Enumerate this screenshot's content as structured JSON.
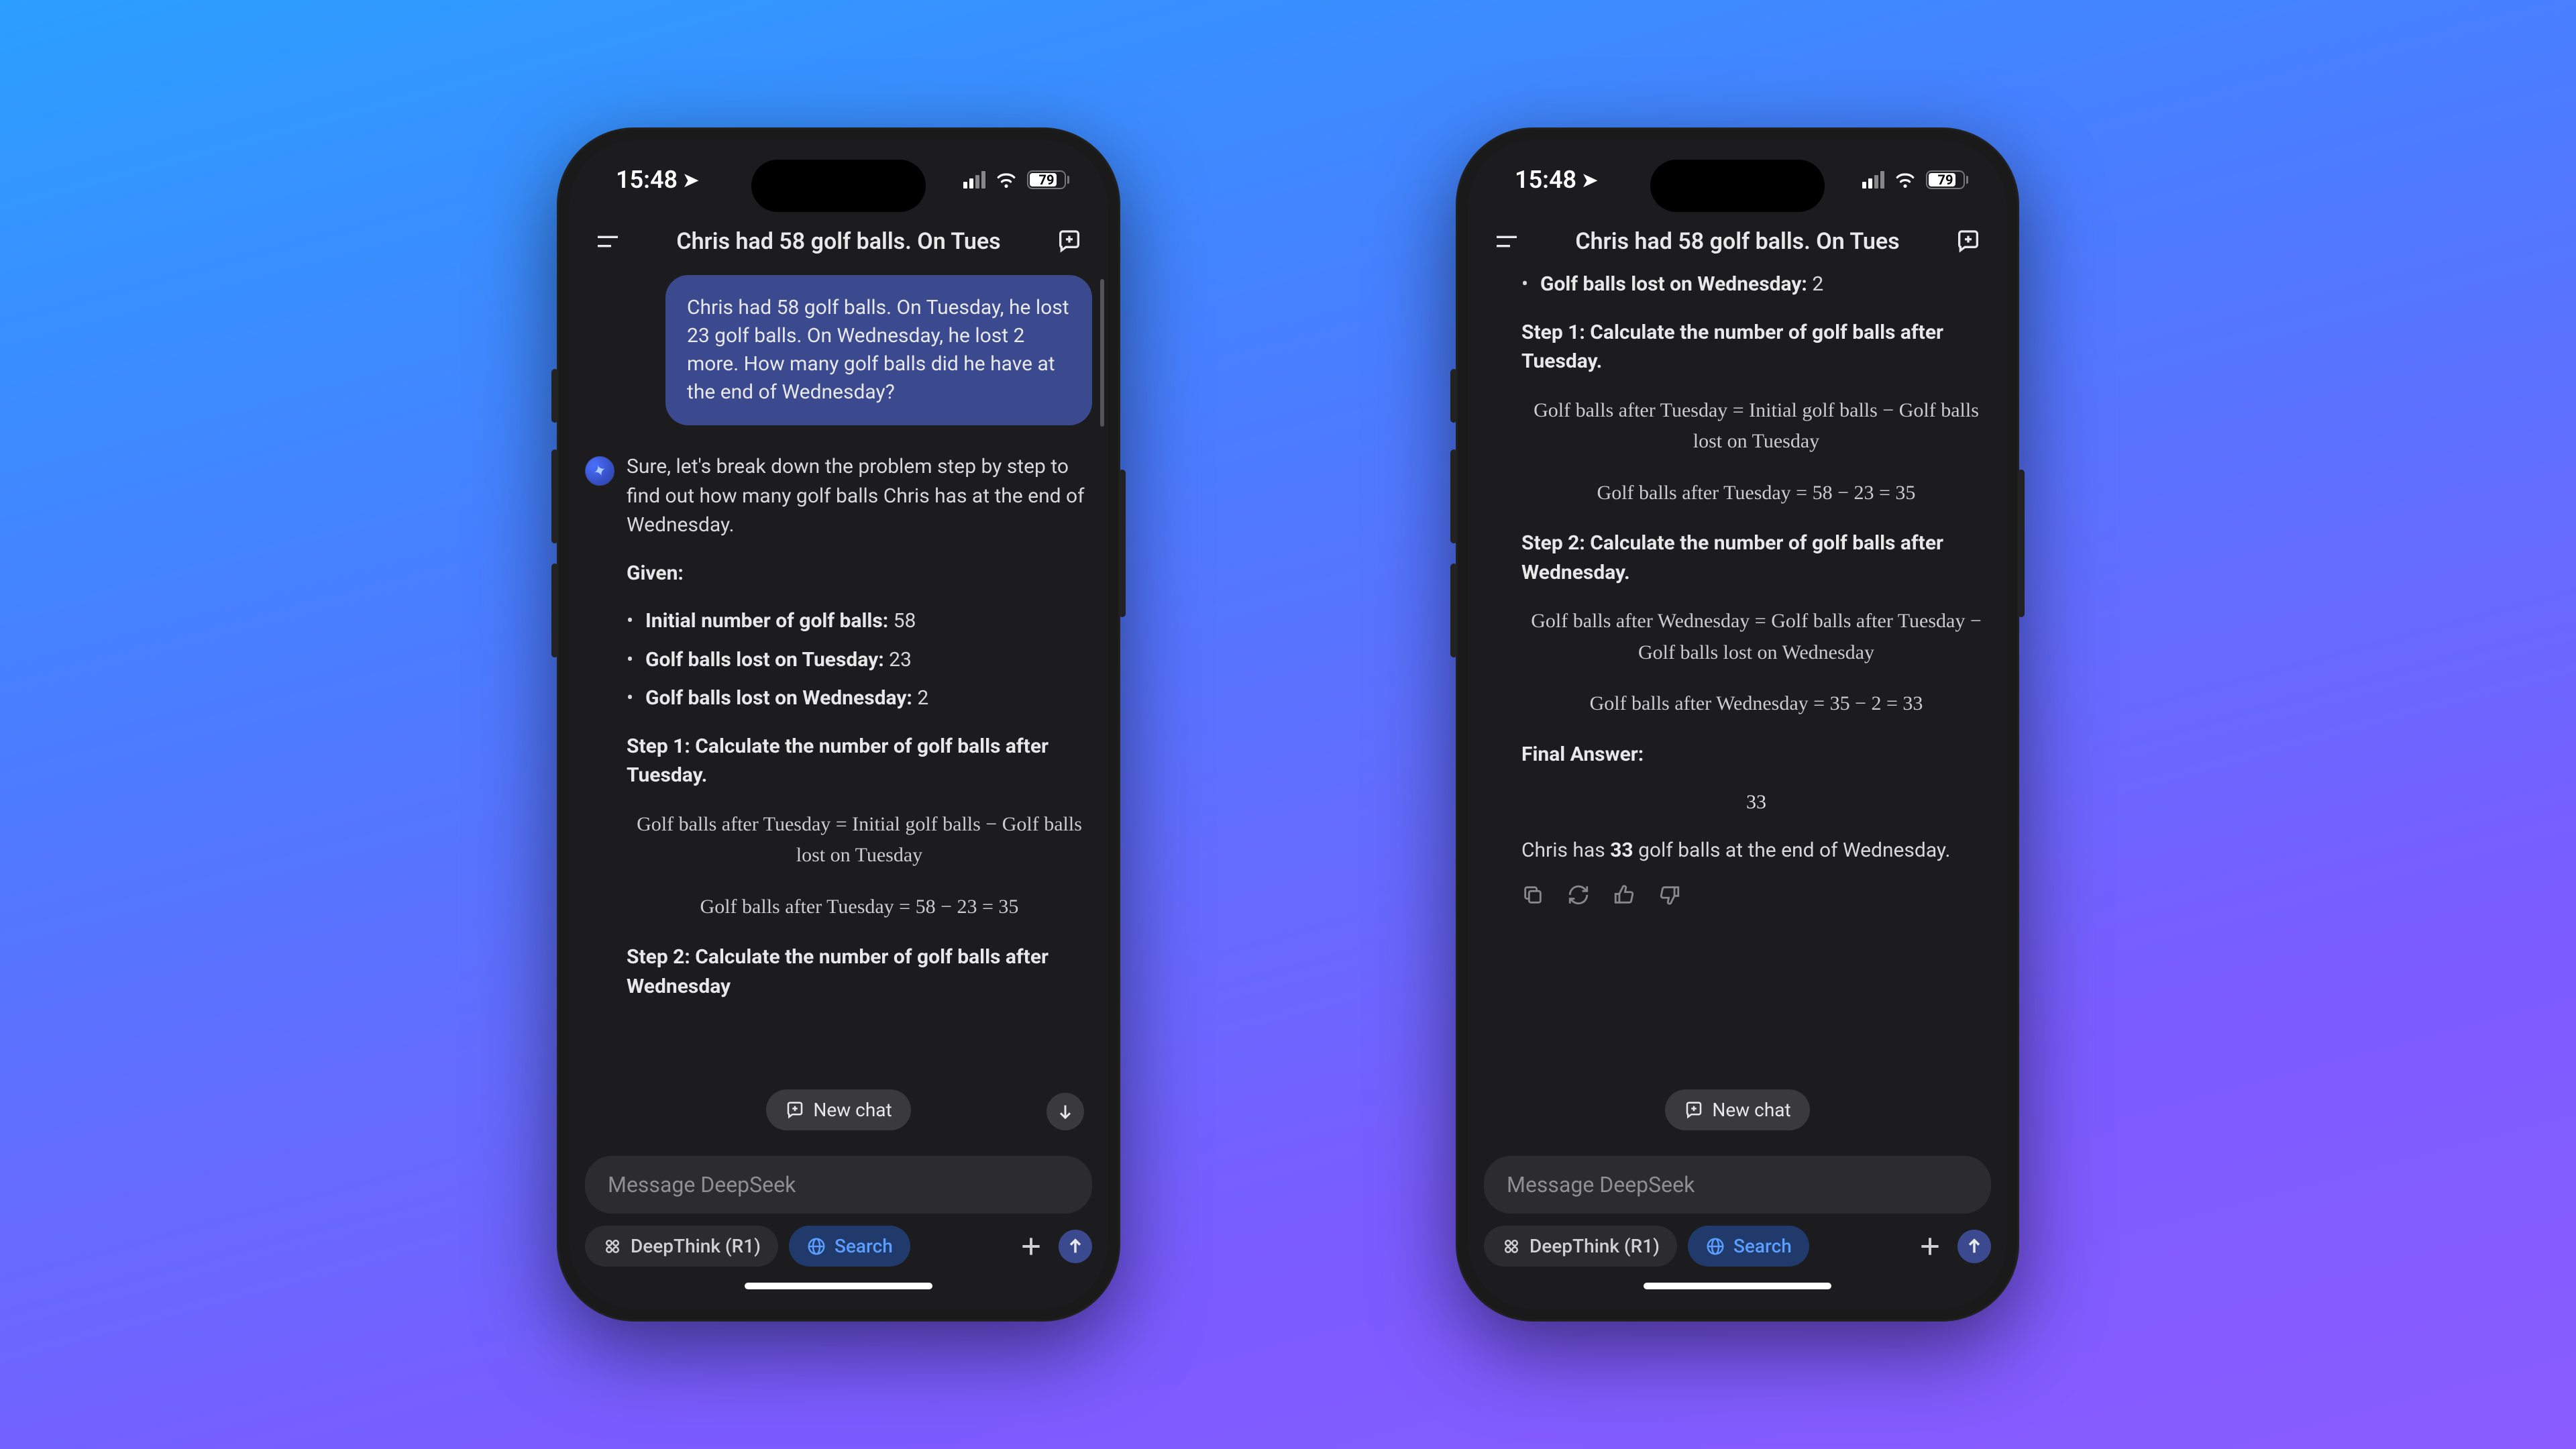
{
  "status": {
    "time": "15:48",
    "battery": "79"
  },
  "header": {
    "title": "Chris had 58 golf balls. On Tues"
  },
  "phone1": {
    "user_msg": "Chris had 58 golf balls. On Tuesday, he lost 23 golf balls. On Wednesday, he lost 2 more. How many golf balls did he have at the end of Wednesday?",
    "intro": "Sure, let's break down the problem step by step to find out how many golf balls Chris has at the end of Wednesday.",
    "given_label": "Given:",
    "g1_l": "Initial number of golf balls:",
    "g1_v": " 58",
    "g2_l": "Golf balls lost on Tuesday:",
    "g2_v": " 23",
    "g3_l": "Golf balls lost on Wednesday:",
    "g3_v": " 2",
    "step1": "Step 1: Calculate the number of golf balls after Tuesday.",
    "eq1a": "Golf balls after Tuesday = Initial golf balls − Golf balls lost on Tuesday",
    "eq1b": "Golf balls after Tuesday = 58 − 23 = 35",
    "step2": "Step 2: Calculate the number of golf balls after Wednesday"
  },
  "phone2": {
    "g3_l": "Golf balls lost on Wednesday:",
    "g3_v": " 2",
    "step1": "Step 1: Calculate the number of golf balls after Tuesday.",
    "eq1a": "Golf balls after Tuesday = Initial golf balls − Golf balls lost on Tuesday",
    "eq1b": "Golf balls after Tuesday = 58 − 23 = 35",
    "step2": "Step 2: Calculate the number of golf balls after Wednesday.",
    "eq2a": "Golf balls after Wednesday = Golf balls after Tuesday − Golf balls lost on Wednesday",
    "eq2b": "Golf balls after Wednesday = 35 − 2 = 33",
    "final_label": "Final Answer:",
    "final_num": "33",
    "conc_pre": "Chris has ",
    "conc_bold": "33",
    "conc_post": " golf balls at the end of Wednesday."
  },
  "float": {
    "new_chat": "New chat"
  },
  "input": {
    "placeholder": "Message DeepSeek",
    "deepthink": "DeepThink (R1)",
    "search": "Search"
  }
}
